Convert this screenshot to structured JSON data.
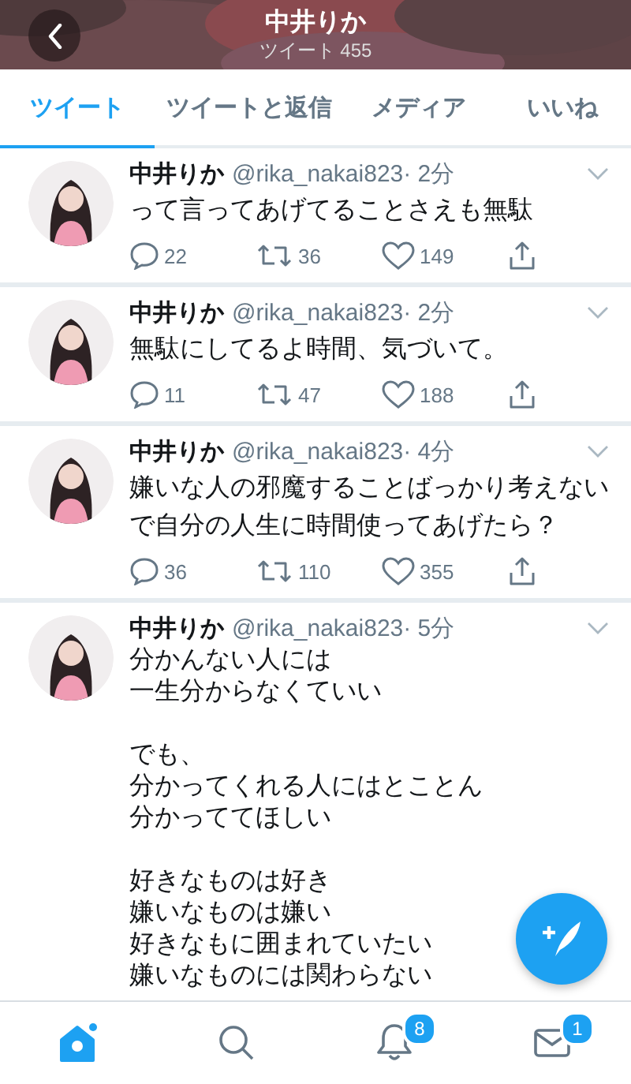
{
  "header": {
    "title": "中井りか",
    "subtitle": "ツイート 455"
  },
  "tabs": [
    {
      "label": "ツイート",
      "selected": true
    },
    {
      "label": "ツイートと返信",
      "selected": false
    },
    {
      "label": "メディア",
      "selected": false
    },
    {
      "label": "いいね",
      "selected": false
    }
  ],
  "tweets": [
    {
      "name": "中井りか",
      "handle": "@rika_nakai823",
      "time": "· 2分",
      "paragraphs": [
        "って言ってあげてることさえも無駄"
      ],
      "replies": "22",
      "retweets": "36",
      "likes": "149"
    },
    {
      "name": "中井りか",
      "handle": "@rika_nakai823",
      "time": "· 2分",
      "paragraphs": [
        "無駄にしてるよ時間、気づいて。"
      ],
      "replies": "11",
      "retweets": "47",
      "likes": "188"
    },
    {
      "name": "中井りか",
      "handle": "@rika_nakai823",
      "time": "· 4分",
      "paragraphs": [
        "嫌いな人の邪魔することばっかり考えないで自分の人生に時間使ってあげたら？"
      ],
      "replies": "36",
      "retweets": "110",
      "likes": "355"
    },
    {
      "name": "中井りか",
      "handle": "@rika_nakai823",
      "time": "· 5分",
      "paragraphs": [
        [
          "分かんない人には",
          "一生分からなくていい"
        ],
        [
          "でも、",
          "分かってくれる人にはとことん",
          "分かっててほしい"
        ],
        [
          "好きなものは好き",
          "嫌いなものは嫌い",
          "好きなもに囲まれていたい",
          "嫌いなものには関わらない"
        ]
      ]
    }
  ],
  "nav": [
    {
      "kind": "home",
      "selected": true
    },
    {
      "kind": "search",
      "selected": false
    },
    {
      "kind": "bell",
      "selected": false,
      "badge": "8"
    },
    {
      "kind": "mail",
      "selected": false,
      "badge": "1"
    }
  ]
}
